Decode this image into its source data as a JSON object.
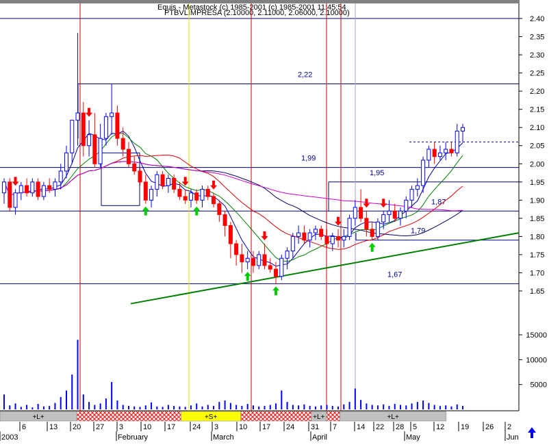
{
  "header": {
    "line1": "Equis - Metastock (c) 1985-2001 (c) 1985-2001 11:45:54",
    "line2": "PTBVLIMPRESA (2.10000, 2.11000, 2.06000, 2.10000)"
  },
  "colors": {
    "up_candle": "#0000ff",
    "down_candle": "#ff0000",
    "ma_fast": "#0000aa",
    "ma_mid": "#008000",
    "ma_slow": "#dd0000",
    "ma_long": "#000060",
    "ma_longest": "#cc00cc",
    "trendline": "#008000",
    "grid_line": "#000080",
    "sell_arrow": "#ff0000",
    "buy_arrow": "#00cc00",
    "volume": "#0000ff",
    "band_L": "#c0c0c0",
    "band_S": "#ffff00",
    "band_neutral": "#ff0000"
  },
  "chart_data": {
    "type": "candlestick",
    "title": "PTBVLIMPRESA (2.10000, 2.11000, 2.06000, 2.10000)",
    "ylim": [
      1.6,
      2.45
    ],
    "y_ticks": [
      "2.40",
      "2.35",
      "2.30",
      "2.25",
      "2.20",
      "2.15",
      "2.10",
      "2.05",
      "2.00",
      "1.95",
      "1.90",
      "1.85",
      "1.80",
      "1.75",
      "1.70",
      "1.65"
    ],
    "volume_ticks": [
      "15000",
      "10000",
      "5000"
    ],
    "volume_ylim": [
      0,
      19000
    ],
    "x_ticks": [
      "6",
      "13",
      "20",
      "27",
      "3",
      "10",
      "17",
      "24",
      "3",
      "10",
      "17",
      "24",
      "31",
      "7",
      "14",
      "22",
      "28",
      "5",
      "12",
      "19",
      "26",
      "2"
    ],
    "month_labels": [
      "2003",
      "February",
      "March",
      "April",
      "May",
      "Jun"
    ],
    "horizontal_levels": [
      {
        "value": 2.22,
        "label": "2,22"
      },
      {
        "value": 1.99,
        "label": "1,99"
      },
      {
        "value": 1.95,
        "label": "1,95"
      },
      {
        "value": 1.87,
        "label": "1,87"
      },
      {
        "value": 1.79,
        "label": "1,79"
      },
      {
        "value": 1.67,
        "label": "1,67"
      },
      {
        "value": 2.4,
        "label": ""
      }
    ],
    "resistance_dashed": 2.06,
    "trendline": {
      "from": [
        0.25,
        1.615
      ],
      "to": [
        1.0,
        1.81
      ]
    },
    "candles": [
      [
        1.92,
        1.96,
        1.89,
        1.95
      ],
      [
        1.95,
        1.96,
        1.87,
        1.88
      ],
      [
        1.88,
        1.93,
        1.86,
        1.92
      ],
      [
        1.92,
        1.95,
        1.9,
        1.94
      ],
      [
        1.94,
        1.96,
        1.91,
        1.92
      ],
      [
        1.92,
        1.96,
        1.91,
        1.95
      ],
      [
        1.95,
        1.96,
        1.9,
        1.91
      ],
      [
        1.91,
        1.95,
        1.9,
        1.94
      ],
      [
        1.94,
        1.96,
        1.92,
        1.93
      ],
      [
        1.93,
        1.96,
        1.91,
        1.95
      ],
      [
        1.95,
        2.0,
        1.93,
        1.98
      ],
      [
        1.98,
        2.05,
        1.96,
        2.03
      ],
      [
        2.03,
        2.12,
        2.0,
        2.12
      ],
      [
        2.12,
        2.36,
        2.05,
        2.14
      ],
      [
        2.14,
        2.17,
        2.02,
        2.05
      ],
      [
        2.05,
        2.12,
        2.02,
        2.08
      ],
      [
        2.08,
        2.14,
        1.99,
        2.0
      ],
      [
        2.0,
        2.11,
        1.99,
        2.07
      ],
      [
        2.07,
        2.14,
        2.05,
        2.13
      ],
      [
        2.13,
        2.22,
        2.08,
        2.14
      ],
      [
        2.14,
        2.16,
        2.05,
        2.07
      ],
      [
        2.07,
        2.1,
        2.02,
        2.04
      ],
      [
        2.04,
        2.06,
        1.99,
        2.0
      ],
      [
        2.0,
        2.02,
        1.97,
        1.98
      ],
      [
        1.98,
        1.99,
        1.94,
        1.95
      ],
      [
        1.95,
        1.97,
        1.89,
        1.9
      ],
      [
        1.9,
        1.94,
        1.88,
        1.93
      ],
      [
        1.93,
        1.98,
        1.91,
        1.97
      ],
      [
        1.97,
        1.98,
        1.93,
        1.94
      ],
      [
        1.94,
        1.97,
        1.92,
        1.96
      ],
      [
        1.96,
        1.97,
        1.92,
        1.93
      ],
      [
        1.93,
        1.95,
        1.9,
        1.91
      ],
      [
        1.91,
        1.93,
        1.89,
        1.9
      ],
      [
        1.9,
        1.93,
        1.88,
        1.92
      ],
      [
        1.92,
        1.93,
        1.89,
        1.9
      ],
      [
        1.9,
        1.94,
        1.88,
        1.93
      ],
      [
        1.93,
        1.94,
        1.9,
        1.91
      ],
      [
        1.91,
        1.92,
        1.88,
        1.89
      ],
      [
        1.89,
        1.9,
        1.84,
        1.86
      ],
      [
        1.86,
        1.87,
        1.8,
        1.83
      ],
      [
        1.83,
        1.84,
        1.74,
        1.78
      ],
      [
        1.78,
        1.79,
        1.72,
        1.75
      ],
      [
        1.75,
        1.78,
        1.7,
        1.73
      ],
      [
        1.73,
        1.76,
        1.71,
        1.74
      ],
      [
        1.74,
        1.76,
        1.7,
        1.72
      ],
      [
        1.72,
        1.76,
        1.71,
        1.75
      ],
      [
        1.75,
        1.78,
        1.71,
        1.72
      ],
      [
        1.72,
        1.74,
        1.7,
        1.71
      ],
      [
        1.71,
        1.73,
        1.67,
        1.69
      ],
      [
        1.69,
        1.75,
        1.68,
        1.74
      ],
      [
        1.74,
        1.77,
        1.71,
        1.76
      ],
      [
        1.76,
        1.81,
        1.74,
        1.8
      ],
      [
        1.8,
        1.83,
        1.78,
        1.81
      ],
      [
        1.81,
        1.83,
        1.78,
        1.79
      ],
      [
        1.79,
        1.82,
        1.77,
        1.81
      ],
      [
        1.81,
        1.83,
        1.79,
        1.82
      ],
      [
        1.82,
        1.83,
        1.79,
        1.8
      ],
      [
        1.8,
        1.82,
        1.77,
        1.78
      ],
      [
        1.78,
        1.81,
        1.76,
        1.8
      ],
      [
        1.8,
        1.82,
        1.77,
        1.79
      ],
      [
        1.79,
        1.82,
        1.77,
        1.8
      ],
      [
        1.8,
        1.86,
        1.79,
        1.85
      ],
      [
        1.85,
        1.9,
        1.83,
        1.88
      ],
      [
        1.88,
        1.93,
        1.84,
        1.85
      ],
      [
        1.85,
        1.87,
        1.8,
        1.82
      ],
      [
        1.82,
        1.84,
        1.79,
        1.8
      ],
      [
        1.8,
        1.85,
        1.79,
        1.84
      ],
      [
        1.84,
        1.87,
        1.82,
        1.86
      ],
      [
        1.86,
        1.9,
        1.84,
        1.87
      ],
      [
        1.87,
        1.89,
        1.84,
        1.85
      ],
      [
        1.85,
        1.88,
        1.83,
        1.87
      ],
      [
        1.87,
        1.91,
        1.85,
        1.9
      ],
      [
        1.9,
        1.94,
        1.88,
        1.93
      ],
      [
        1.93,
        1.96,
        1.91,
        1.94
      ],
      [
        1.94,
        2.02,
        1.92,
        2.01
      ],
      [
        2.01,
        2.05,
        1.99,
        2.04
      ],
      [
        2.04,
        2.06,
        2.0,
        2.02
      ],
      [
        2.02,
        2.05,
        2.01,
        2.03
      ],
      [
        2.03,
        2.06,
        2.01,
        2.04
      ],
      [
        2.04,
        2.06,
        2.02,
        2.03
      ],
      [
        2.03,
        2.11,
        2.02,
        2.09
      ],
      [
        2.09,
        2.11,
        2.06,
        2.1
      ]
    ],
    "volume": [
      3000,
      800,
      1200,
      500,
      900,
      400,
      1100,
      600,
      700,
      1300,
      2500,
      3800,
      7000,
      14000,
      3000,
      1500,
      900,
      1200,
      2200,
      5500,
      1800,
      900,
      700,
      600,
      500,
      800,
      1400,
      600,
      500,
      900,
      700,
      600,
      500,
      800,
      1200,
      600,
      900,
      700,
      1500,
      1800,
      1300,
      900,
      700,
      1100,
      800,
      600,
      700,
      900,
      1200,
      3800,
      1500,
      900,
      800,
      1000,
      700,
      600,
      800,
      900,
      700,
      600,
      1000,
      1500,
      4200,
      1900,
      1200,
      900,
      800,
      1000,
      700,
      1100,
      900,
      800,
      1200,
      1500,
      1800,
      1300,
      900,
      700,
      800,
      600,
      1000,
      700
    ],
    "sell_signals": [
      2,
      15,
      32,
      37,
      46,
      59,
      64,
      67
    ],
    "buy_signals": [
      25,
      34,
      43,
      48,
      65
    ],
    "signal_bands": [
      {
        "label": "+L+",
        "from": 0.0,
        "to": 0.148
      },
      {
        "label": "",
        "from": 0.148,
        "to": 0.349
      },
      {
        "label": "+S+",
        "from": 0.349,
        "to": 0.464
      },
      {
        "label": "",
        "from": 0.464,
        "to": 0.6
      },
      {
        "label": "+L+",
        "from": 0.6,
        "to": 0.629
      },
      {
        "label": "",
        "from": 0.629,
        "to": 0.655
      },
      {
        "label": "+L+",
        "from": 0.655,
        "to": 0.86
      }
    ],
    "grid": false
  },
  "ui": {
    "scroll_up_icon": "arrow-up-icon"
  }
}
